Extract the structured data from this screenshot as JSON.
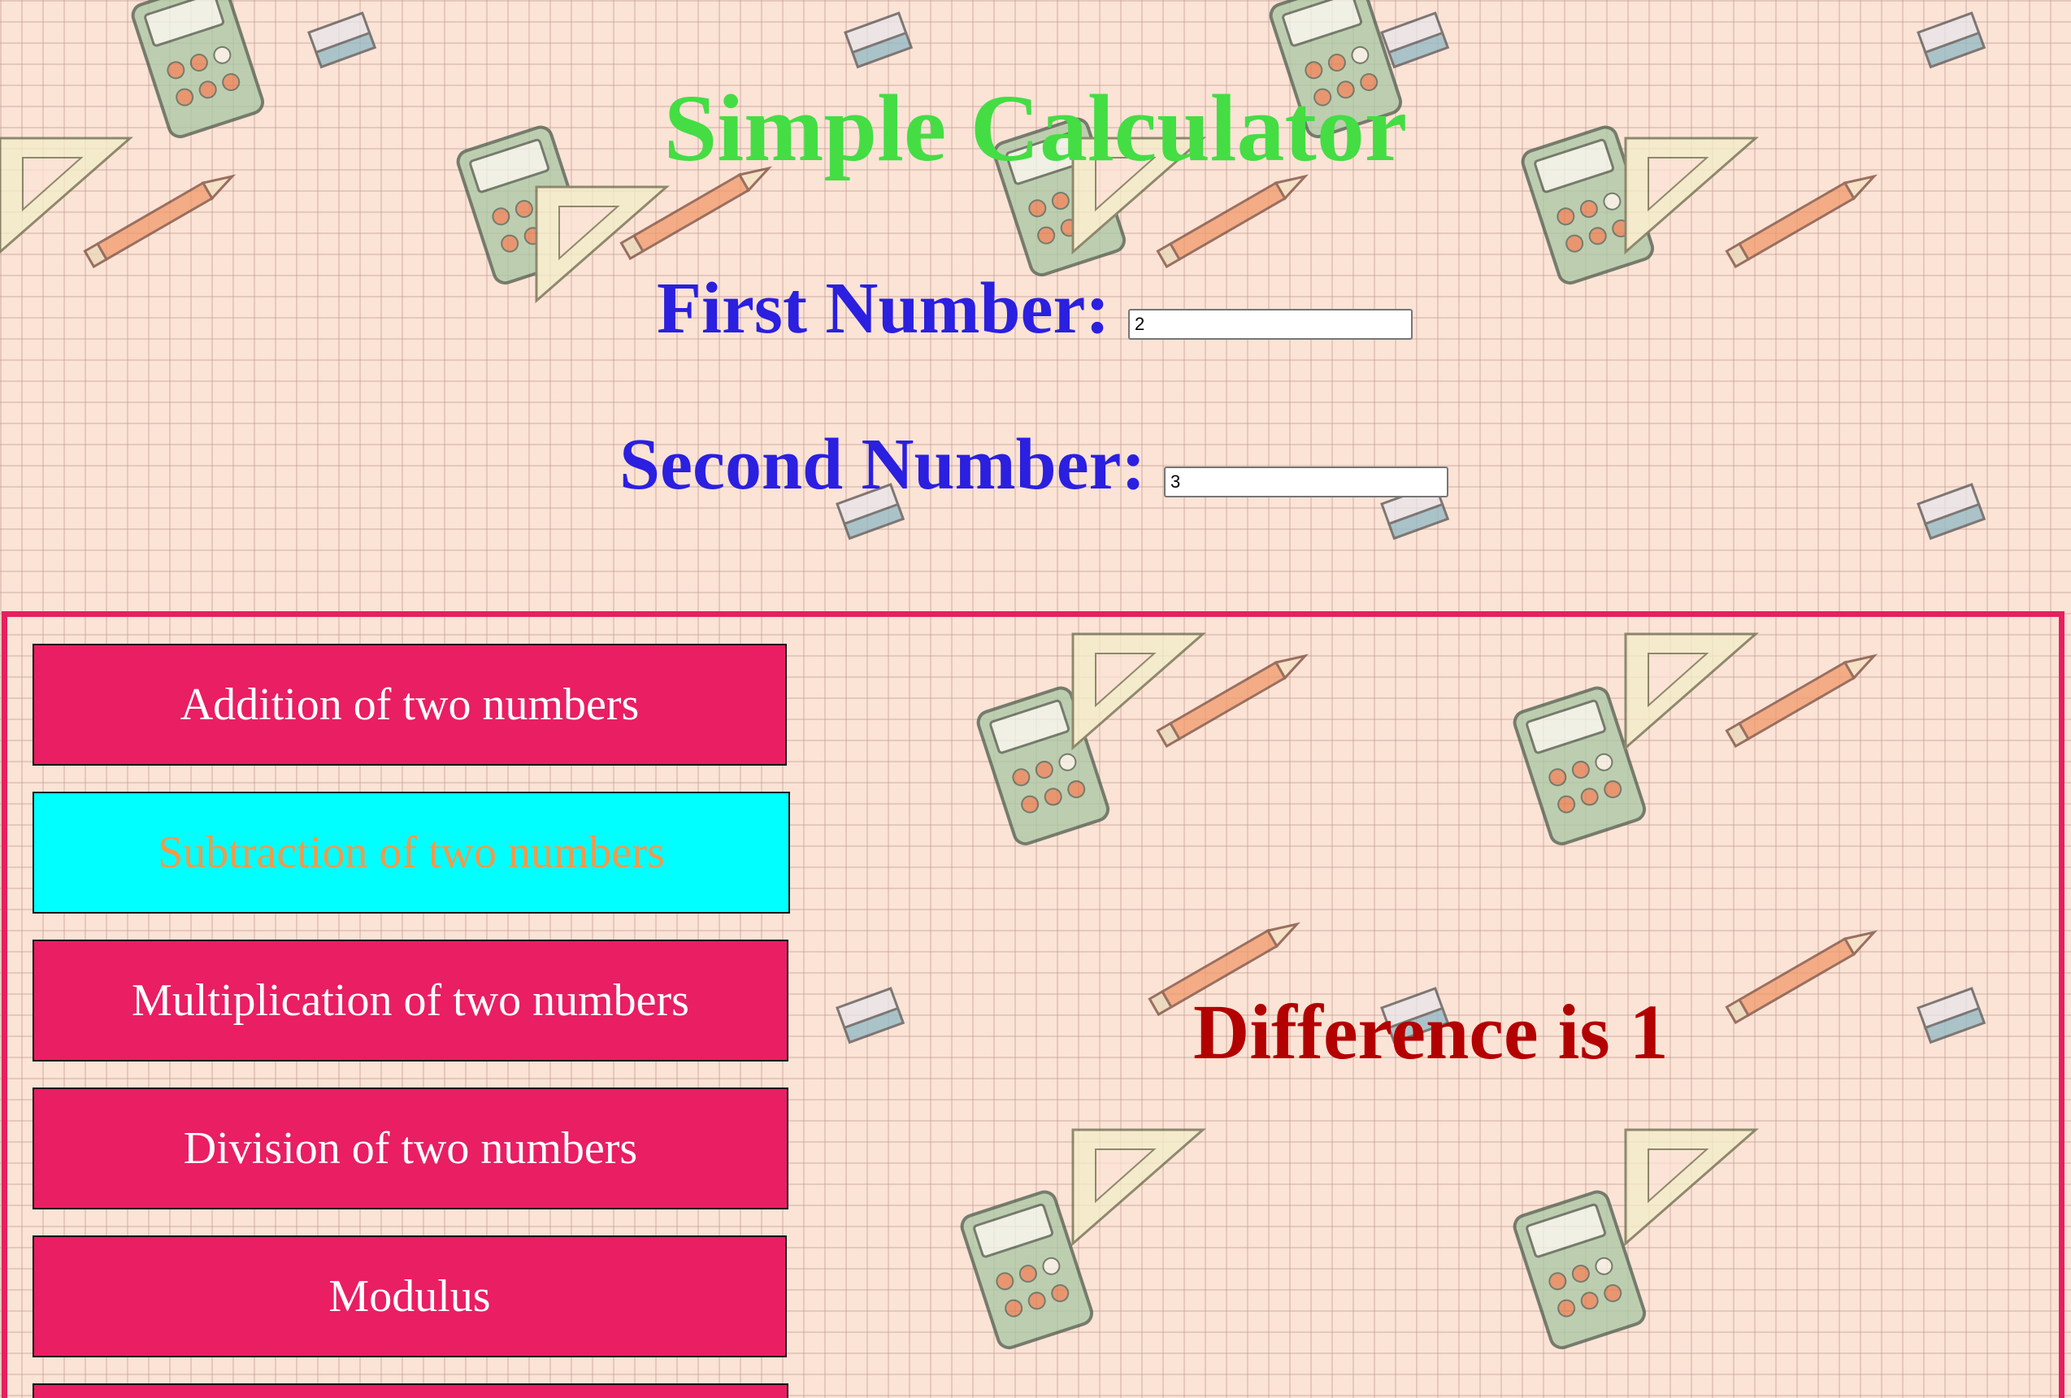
{
  "app": {
    "title": "Simple Calculator"
  },
  "form": {
    "first_label": "First Number:",
    "first_value": "2",
    "second_label": "Second Number:",
    "second_value": "3"
  },
  "operations": [
    {
      "label": "Addition of two numbers",
      "active": false
    },
    {
      "label": "Subtraction of two numbers",
      "active": true
    },
    {
      "label": "Multiplication of two numbers",
      "active": false
    },
    {
      "label": "Division of two numbers",
      "active": false
    },
    {
      "label": "Modulus",
      "active": false
    }
  ],
  "result": {
    "text": "Difference is 1"
  },
  "colors": {
    "title": "#44dd44",
    "label": "#2b1fe0",
    "button": "#e91e63",
    "button_active": "#00ffff",
    "button_active_text": "#f2994a",
    "result": "#b30000",
    "panel_border": "#e6205f"
  },
  "background": {
    "pattern": "stationery-calculator-wallpaper"
  }
}
